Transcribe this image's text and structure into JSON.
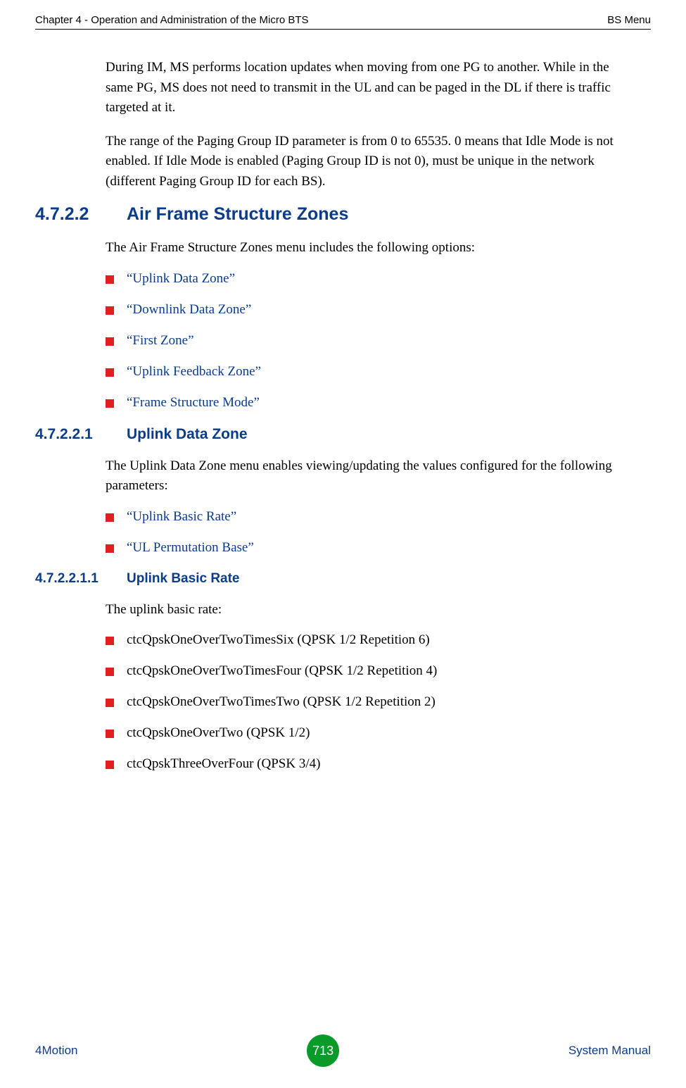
{
  "header": {
    "left": "Chapter 4 - Operation and Administration of the Micro BTS",
    "right": "BS Menu"
  },
  "p1": "During IM, MS performs location updates when moving from one PG to another. While in the same PG, MS does not need to transmit in the UL and can be paged in the DL if there is traffic targeted at it.",
  "p2": "The range of the Paging Group ID parameter is from 0 to 65535. 0 means that Idle Mode is not enabled. If Idle Mode is enabled (Paging Group ID is not 0), must be unique in the network (different Paging Group ID for each BS).",
  "sec_afsz": {
    "num": "4.7.2.2",
    "title": "Air Frame Structure Zones",
    "intro": "The Air Frame Structure Zones menu includes the following options:",
    "items": [
      "“Uplink Data Zone”",
      "“Downlink Data Zone”",
      "“First Zone”",
      "“Uplink Feedback Zone”",
      "“Frame Structure Mode”"
    ]
  },
  "sec_udz": {
    "num": "4.7.2.2.1",
    "title": "Uplink Data Zone",
    "intro": "The Uplink Data Zone menu enables viewing/updating the values configured for the following parameters:",
    "items": [
      "“Uplink Basic Rate”",
      "“UL Permutation Base”"
    ]
  },
  "sec_ubr": {
    "num": "4.7.2.2.1.1",
    "title": "Uplink Basic Rate",
    "intro": "The uplink basic rate:",
    "items": [
      "ctcQpskOneOverTwoTimesSix (QPSK 1/2 Repetition 6)",
      "ctcQpskOneOverTwoTimesFour (QPSK 1/2 Repetition 4)",
      "ctcQpskOneOverTwoTimesTwo (QPSK 1/2 Repetition 2)",
      "ctcQpskOneOverTwo (QPSK 1/2)",
      "ctcQpskThreeOverFour (QPSK 3/4)"
    ]
  },
  "footer": {
    "left": "4Motion",
    "page": "713",
    "right": "System Manual"
  }
}
